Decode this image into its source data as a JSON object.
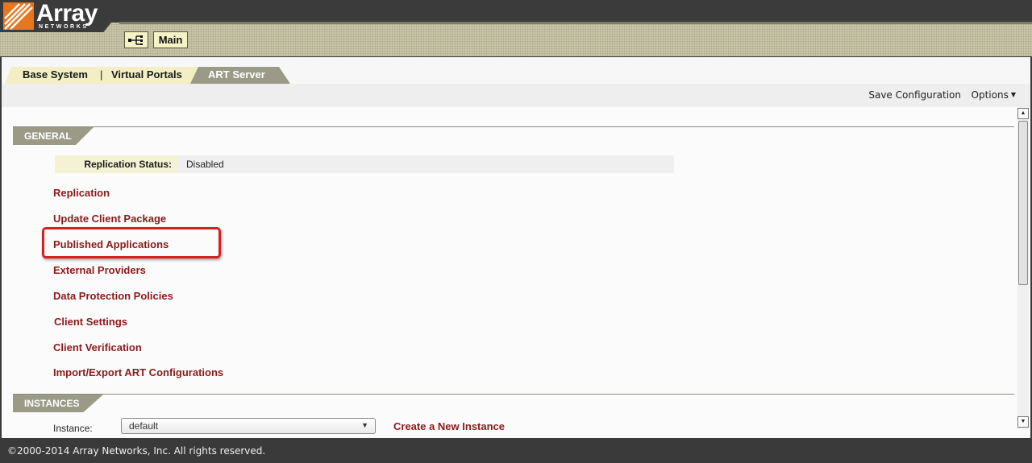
{
  "brand": {
    "name": "Array",
    "subtitle": "NETWORKS",
    "colors": {
      "logo_orange": "#e8761e",
      "header_dark": "#3b3b3b",
      "link_red": "#8b1a1a",
      "highlight_red": "#d42020"
    }
  },
  "header": {
    "network_icon": "network-topology-icon",
    "main_label": "Main"
  },
  "tabs": {
    "base_system": "Base System",
    "separator": "|",
    "virtual_portals": "Virtual Portals",
    "art_server": "ART Server",
    "active": "ART Server"
  },
  "toolbar": {
    "save_configuration": "Save Configuration",
    "options": "Options",
    "options_caret": "▼"
  },
  "general": {
    "title": "GENERAL",
    "replication_status_label": "Replication Status:",
    "replication_status_value": "Disabled",
    "links": [
      "Replication",
      "Update Client Package",
      "Published Applications",
      "External Providers",
      "Data Protection Policies",
      "Client Settings",
      "Client Verification",
      "Import/Export ART Configurations"
    ],
    "highlighted_link": "Published Applications"
  },
  "instances": {
    "title": "INSTANCES",
    "instance_label": "Instance:",
    "instance_value": "default",
    "create_link": "Create a New Instance"
  },
  "scrollbar": {
    "up": "▲",
    "down": "▼"
  },
  "footer": {
    "copyright": "©2000-2014 Array Networks, Inc. All rights reserved."
  }
}
